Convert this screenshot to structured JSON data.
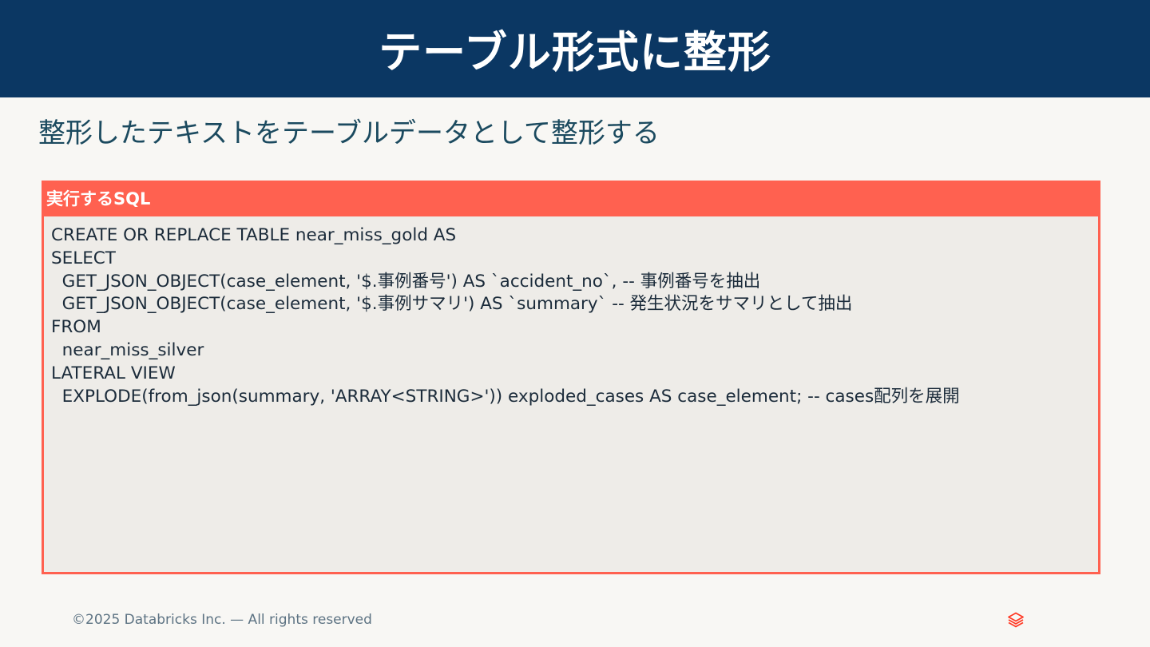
{
  "slide": {
    "title": "テーブル形式に整形",
    "subtitle": "整形したテキストをテーブルデータとして整形する"
  },
  "code_panel": {
    "header": "実行するSQL",
    "lines": [
      "CREATE OR REPLACE TABLE near_miss_gold AS",
      "SELECT",
      "  GET_JSON_OBJECT(case_element, '$.事例番号') AS `accident_no`, -- 事例番号を抽出",
      "  GET_JSON_OBJECT(case_element, '$.事例サマリ') AS `summary` -- 発生状況をサマリとして抽出",
      "FROM",
      "  near_miss_silver",
      "LATERAL VIEW",
      "  EXPLODE(from_json(summary, 'ARRAY<STRING>')) exploded_cases AS case_element; -- cases配列を展開"
    ]
  },
  "footer": {
    "copyright": "©2025 Databricks Inc. — All rights reserved",
    "logo_icon": "databricks-logo-icon"
  },
  "colors": {
    "header_bg": "#0b3763",
    "accent": "#ff6150",
    "page_bg": "#f8f7f4",
    "code_bg": "#eeece8",
    "subtitle": "#1b4a5f"
  }
}
